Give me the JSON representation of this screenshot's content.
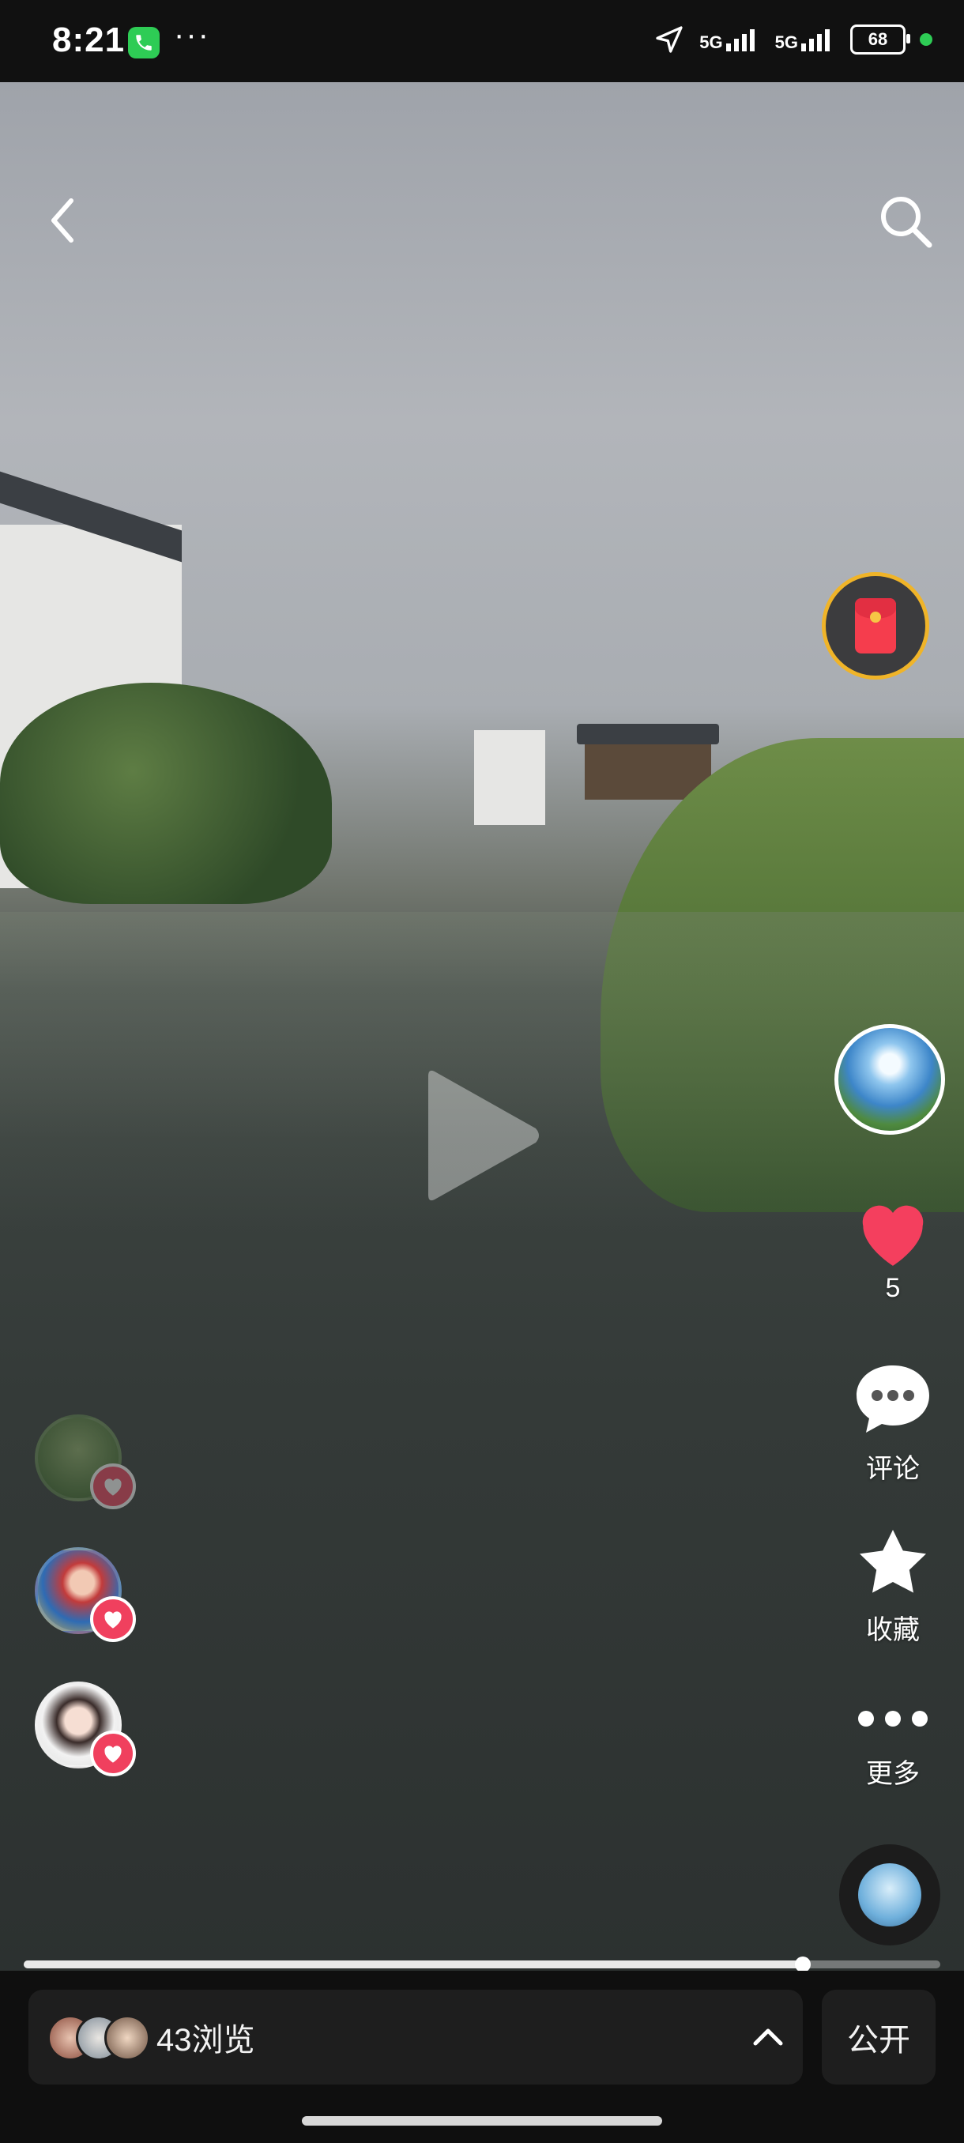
{
  "status_bar": {
    "time": "8:21",
    "overflow_dots": "···",
    "network_1": "5G",
    "network_2": "5G",
    "battery_level": "68"
  },
  "top_bar": {
    "back_icon": "chevron-left-icon",
    "search_icon": "search-icon"
  },
  "video": {
    "playback_progress": 0.85,
    "play_icon": "play-icon"
  },
  "actions": {
    "likes_count": "5",
    "comment_label": "评论",
    "favorite_label": "收藏",
    "more_label": "更多"
  },
  "bottom_bar": {
    "views_text": "43浏览",
    "visibility_label": "公开"
  },
  "colors": {
    "like_red": "#f43f5e",
    "call_green": "#2ecc55",
    "redpacket_ring": "#f0b428"
  }
}
